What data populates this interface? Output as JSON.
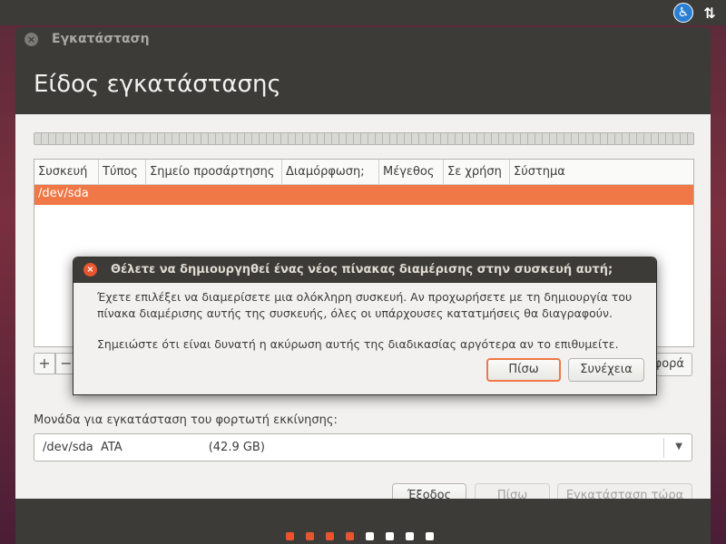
{
  "window": {
    "title": "Εγκατάσταση",
    "heading": "Είδος εγκατάστασης"
  },
  "table": {
    "columns": [
      "Συσκευή",
      "Τύπος",
      "Σημείο προσάρτησης",
      "Διαμόρφωση;",
      "Μέγεθος",
      "Σε χρήση",
      "Σύστημα"
    ],
    "rows": [
      {
        "device": "/dev/sda"
      }
    ]
  },
  "toolbar": {
    "add_label": "+",
    "remove_label": "−",
    "revert_label": "φορά"
  },
  "boot": {
    "label": "Μονάδα για εγκατάσταση του φορτωτή εκκίνησης:",
    "selected": "/dev/sda  ATA                       (42.9 GB)"
  },
  "buttons": {
    "quit": "Έξοδος",
    "back": "Πίσω",
    "install": "Εγκατάσταση τώρα"
  },
  "dialog": {
    "title": "Θέλετε να δημιουργηθεί ένας νέος πίνακας διαμέρισης στην συσκευή αυτή;",
    "line1": "Έχετε επιλέξει να διαμερίσετε μια ολόκληρη συσκευή. Αν προχωρήσετε με τη δημιουργία του",
    "line2": "πίνακα διαμέρισης αυτής της συσκευής, όλες οι υπάρχουσες κατατμήσεις θα διαγραφούν.",
    "line3": "Σημειώστε ότι είναι δυνατή η ακύρωση αυτής της διαδικασίας αργότερα αν το επιθυμείτε.",
    "back": "Πίσω",
    "continue": "Συνέχεια"
  },
  "progress": {
    "total_steps": 8,
    "completed_steps": 4,
    "active_color": "#e8552f",
    "inactive_color": "#ffffff"
  },
  "colors": {
    "accent": "#f07746"
  },
  "icons": {
    "accessibility": "accessibility-icon",
    "network": "network-updown-icon",
    "close": "close-icon"
  }
}
